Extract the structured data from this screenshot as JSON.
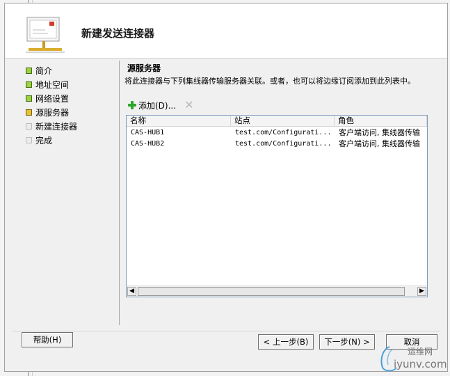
{
  "wizard": {
    "title": "新建发送连接器",
    "nav": [
      {
        "label": "简介",
        "state": "done"
      },
      {
        "label": "地址空间",
        "state": "done"
      },
      {
        "label": "网络设置",
        "state": "done"
      },
      {
        "label": "源服务器",
        "state": "current"
      },
      {
        "label": "新建连接器",
        "state": "todo"
      },
      {
        "label": "完成",
        "state": "todo"
      }
    ]
  },
  "section": {
    "title": "源服务器",
    "description": "将此连接器与下列集线器传输服务器关联。或者，也可以将边缘订阅添加到此列表中。"
  },
  "toolbar": {
    "add_label": "添加(D)...",
    "remove_icon": "remove-icon"
  },
  "table": {
    "columns": [
      "名称",
      "站点",
      "角色"
    ],
    "rows": [
      {
        "name": "CAS-HUB1",
        "site": "test.com/Configurati...",
        "role": "客户端访问, 集线器传输"
      },
      {
        "name": "CAS-HUB2",
        "site": "test.com/Configurati...",
        "role": "客户端访问, 集线器传输"
      }
    ]
  },
  "buttons": {
    "help": "帮助(H)",
    "back": "< 上一步(B)",
    "next": "下一步(N) >",
    "cancel": "取消"
  },
  "watermark": {
    "text_top": "运维网",
    "text_bottom": "iyunv.com"
  },
  "colors": {
    "nav_done": "#9ed041",
    "nav_current": "#e4c23a",
    "nav_todo": "#ececec",
    "add_icon": "#2ea52e",
    "list_border": "#7f9db9"
  }
}
